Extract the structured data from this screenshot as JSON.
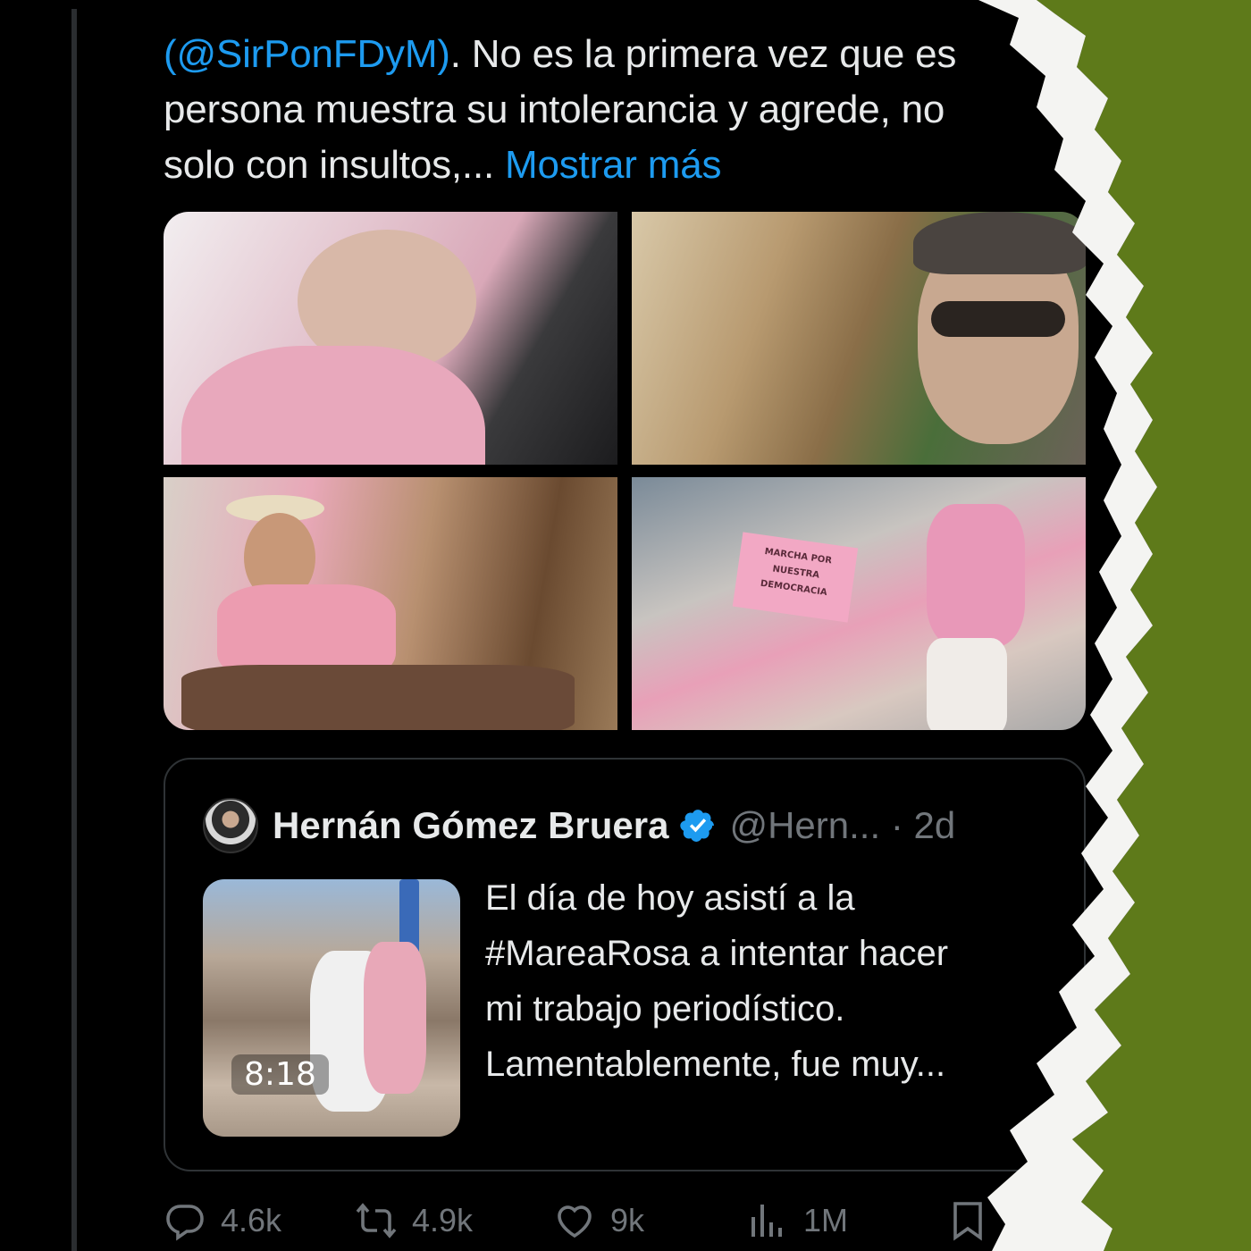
{
  "tweet": {
    "text_lines": [
      {
        "mention": "(@SirPonFDyM)",
        "rest": ". No es la primera vez que es"
      },
      {
        "text": "persona muestra su intolerancia y agrede, no"
      },
      {
        "text": "solo con insultos,... ",
        "more": "Mostrar más"
      }
    ]
  },
  "media": {
    "sign_text": [
      "MARCHA POR",
      "NUESTRA",
      "DEMOCRACIA"
    ]
  },
  "quote": {
    "name": "Hernán Gómez Bruera",
    "handle_time": "@Hern... · 2d",
    "video_duration": "8:18",
    "text_lines": [
      "El día de hoy asistí a la",
      "#MareaRosa a intentar hacer",
      "mi trabajo periodístico.",
      "Lamentablemente, fue muy..."
    ]
  },
  "actions": {
    "replies": "4.6k",
    "reposts": "4.9k",
    "likes": "9k",
    "views": "1M"
  },
  "colors": {
    "background": "#000000",
    "text": "#e7e9ea",
    "link": "#1d9bf0",
    "muted": "#71767b",
    "torn_green": "#5e7a1a"
  }
}
